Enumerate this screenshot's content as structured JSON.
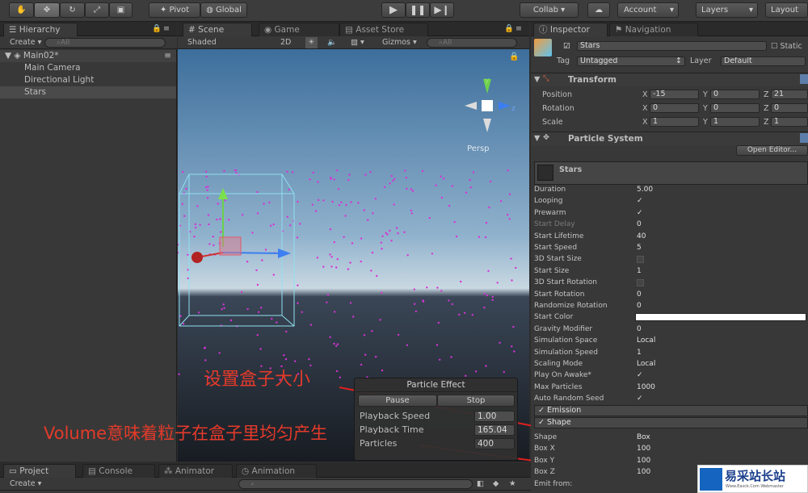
{
  "toolbar": {
    "pivot": "Pivot",
    "global": "Global",
    "collab": "Collab ▾",
    "account": "Account",
    "layers": "Layers",
    "layout": "Layout"
  },
  "hierarchy": {
    "tab": "Hierarchy",
    "create": "Create",
    "search": "All",
    "scene": "Main02*",
    "items": [
      "Main Camera",
      "Directional Light",
      "Stars"
    ]
  },
  "sceneview": {
    "tabs": [
      "Scene",
      "Game",
      "Asset Store"
    ],
    "shaded": "Shaded",
    "mode2d": "2D",
    "gizmos": "Gizmos",
    "search": "All",
    "persp": "Persp",
    "gizmo_y": "y",
    "gizmo_z": "z"
  },
  "annotations": {
    "box_size": "设置盒子大小",
    "volume": "Volume意味着粒子在盒子里均匀产生"
  },
  "particle_effect": {
    "title": "Particle Effect",
    "pause": "Pause",
    "stop": "Stop",
    "playback_speed_label": "Playback Speed",
    "playback_speed": "1.00",
    "playback_time_label": "Playback Time",
    "playback_time": "165.04",
    "particles_label": "Particles",
    "particles": "400"
  },
  "inspector": {
    "tab": "Inspector",
    "nav_tab": "Navigation",
    "object_name": "Stars",
    "static": "Static",
    "tag_label": "Tag",
    "tag": "Untagged",
    "layer_label": "Layer",
    "layer": "Default",
    "transform": {
      "title": "Transform",
      "rows": [
        {
          "label": "Position",
          "x": "-15",
          "y": "0",
          "z": "21"
        },
        {
          "label": "Rotation",
          "x": "0",
          "y": "0",
          "z": "0"
        },
        {
          "label": "Scale",
          "x": "1",
          "y": "1",
          "z": "1"
        }
      ]
    },
    "particle_system": {
      "title": "Particle System",
      "open_editor": "Open Editor...",
      "name": "Stars",
      "props": [
        {
          "label": "Duration",
          "value": "5.00"
        },
        {
          "label": "Looping",
          "value": "✓"
        },
        {
          "label": "Prewarm",
          "value": "✓"
        },
        {
          "label": "Start Delay",
          "value": "0"
        },
        {
          "label": "Start Lifetime",
          "value": "40"
        },
        {
          "label": "Start Speed",
          "value": "5"
        },
        {
          "label": "3D Start Size",
          "value": ""
        },
        {
          "label": "Start Size",
          "value": "1"
        },
        {
          "label": "3D Start Rotation",
          "value": ""
        },
        {
          "label": "Start Rotation",
          "value": "0"
        },
        {
          "label": "Randomize Rotation",
          "value": "0"
        },
        {
          "label": "Start Color",
          "value": ""
        },
        {
          "label": "Gravity Modifier",
          "value": "0"
        },
        {
          "label": "Simulation Space",
          "value": "Local"
        },
        {
          "label": "Simulation Speed",
          "value": "1"
        },
        {
          "label": "Scaling Mode",
          "value": "Local"
        },
        {
          "label": "Play On Awake*",
          "value": "✓"
        },
        {
          "label": "Max Particles",
          "value": "1000"
        },
        {
          "label": "Auto Random Seed",
          "value": "✓"
        }
      ],
      "emission": "Emission",
      "shape_section": "Shape",
      "shape_label": "Shape",
      "shape": "Box",
      "box_x_label": "Box X",
      "box_x": "100",
      "box_y_label": "Box Y",
      "box_y": "100",
      "box_z_label": "Box Z",
      "box_z": "100",
      "emit_from": "Emit from:"
    }
  },
  "bottom": {
    "tabs": [
      "Project",
      "Console",
      "Animator",
      "Animation"
    ],
    "create": "Create"
  },
  "watermark": {
    "site": "易采站长站",
    "sub": "Www.Easck.Com Webmaster"
  }
}
